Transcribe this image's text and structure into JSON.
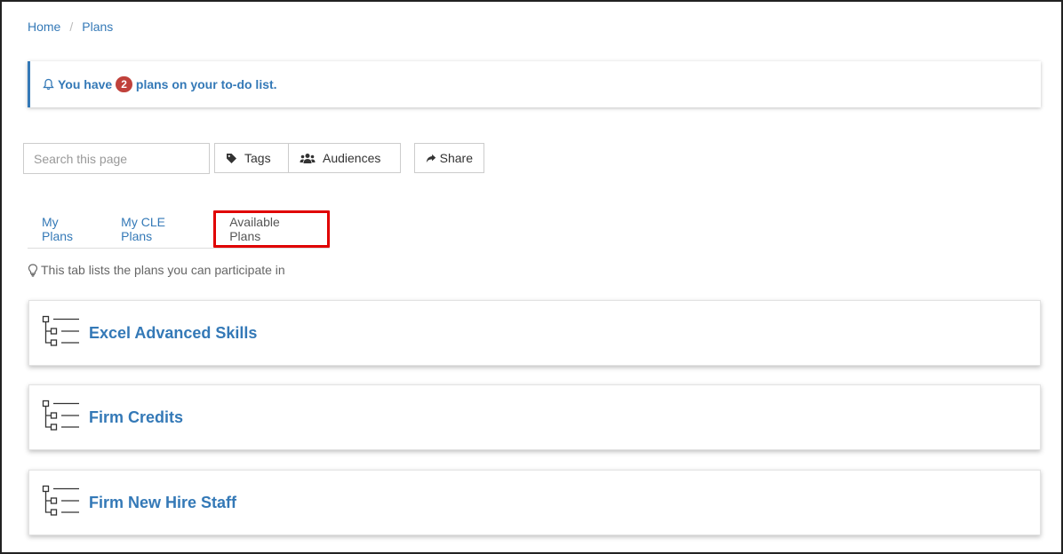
{
  "breadcrumb": {
    "home": "Home",
    "separator": "/",
    "current": "Plans"
  },
  "alert": {
    "prefix": "You have",
    "count": "2",
    "suffix": "plans on your to-do list."
  },
  "toolbar": {
    "search_placeholder": "Search this page",
    "tags_label": "Tags",
    "audiences_label": "Audiences",
    "share_label": "Share"
  },
  "tabs": [
    {
      "label": "My Plans"
    },
    {
      "label": "My CLE Plans"
    },
    {
      "label": "Available Plans",
      "active": true
    }
  ],
  "hint": "This tab lists the plans you can participate in",
  "plans": [
    {
      "title": "Excel Advanced Skills"
    },
    {
      "title": "Firm Credits"
    },
    {
      "title": "Firm New Hire Staff"
    }
  ],
  "colors": {
    "link": "#3479b7",
    "badge": "#c0413b",
    "highlight": "#e00000"
  }
}
